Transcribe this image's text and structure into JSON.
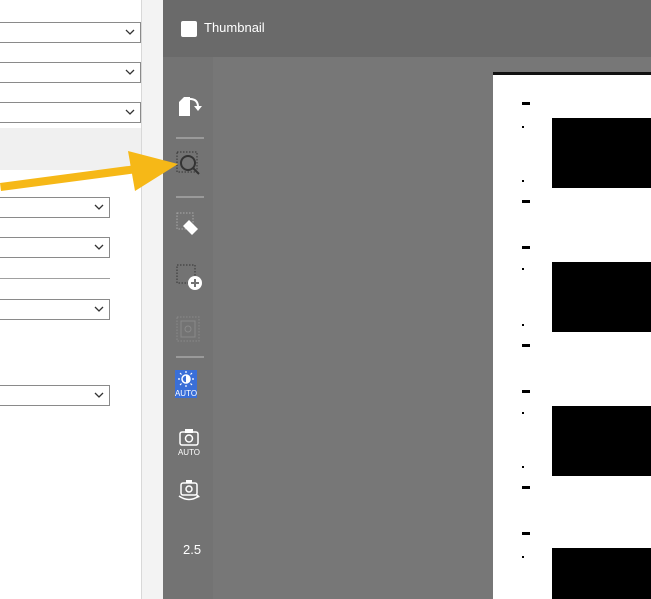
{
  "thumbnail_panel": {
    "label": "Thumbnail"
  },
  "toolbar": {
    "tools": [
      "rotate-page-icon",
      "zoom-icon",
      "eraser-icon",
      "add-selection-icon",
      "auto-crop-icon",
      "auto-brightness-icon",
      "auto-camera-icon",
      "rotate-camera-icon"
    ],
    "auto_badge": "AUTO",
    "camera_auto_label": "AUTO",
    "zoom_value": "2.5"
  },
  "colors": {
    "arrow": "#f6b817",
    "header": "#6a6a6a",
    "toolbar": "#737373",
    "accent_blue": "#3a6fd8"
  }
}
